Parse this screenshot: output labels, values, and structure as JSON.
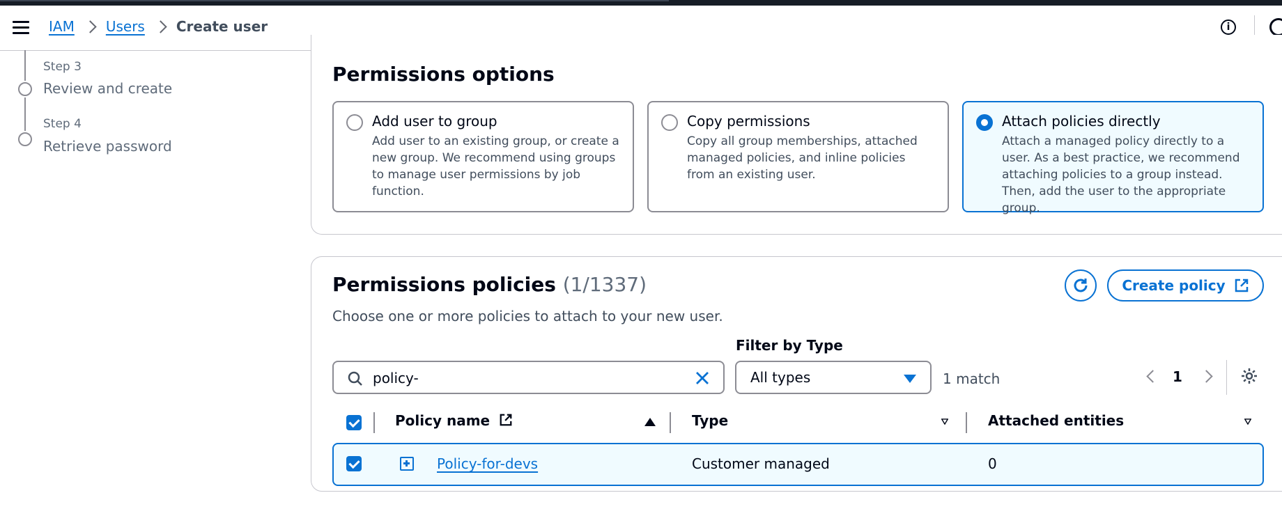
{
  "breadcrumb": [
    "IAM",
    "Users",
    "Create user"
  ],
  "steps": [
    {
      "step": "Step 3",
      "title": "Review and create"
    },
    {
      "step": "Step 4",
      "title": "Retrieve password"
    }
  ],
  "permissions_options": {
    "heading": "Permissions options",
    "options": [
      {
        "title": "Add user to group",
        "desc": "Add user to an existing group, or create a new group. We recommend using groups to manage user permissions by job function.",
        "selected": false
      },
      {
        "title": "Copy permissions",
        "desc": "Copy all group memberships, attached managed policies, and inline policies from an existing user.",
        "selected": false
      },
      {
        "title": "Attach policies directly",
        "desc": "Attach a managed policy directly to a user. As a best practice, we recommend attaching policies to a group instead. Then, add the user to the appropriate group.",
        "selected": true
      }
    ]
  },
  "policies": {
    "heading": "Permissions policies",
    "count": "(1/1337)",
    "subtitle": "Choose one or more policies to attach to your new user.",
    "create_label": "Create policy",
    "filter_label": "Filter by Type",
    "search_value": "policy-",
    "type_select": "All types",
    "match_count": "1 match",
    "page": "1",
    "columns": [
      "Policy name",
      "Type",
      "Attached entities"
    ],
    "rows": [
      {
        "name": "Policy-for-devs",
        "type": "Customer managed",
        "attached": "0"
      }
    ]
  },
  "colors": {
    "accent": "#0972d3",
    "selected_bg": "#f0fbff"
  }
}
